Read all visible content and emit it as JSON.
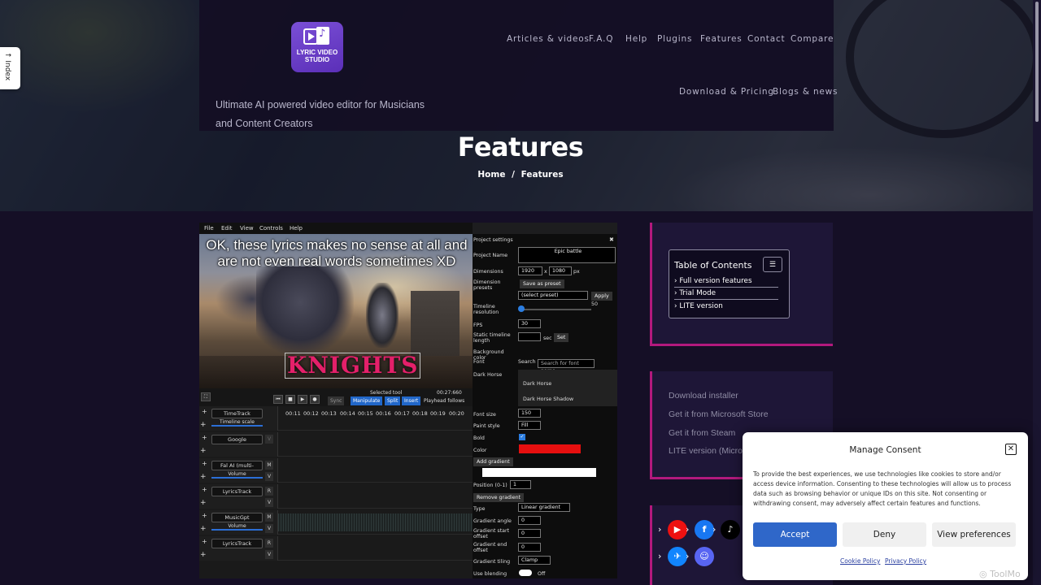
{
  "brand": {
    "logo_text": "LYRIC VIDEO STUDIO",
    "tagline": "Ultimate AI powered video editor for Musicians and Content Creators"
  },
  "nav": {
    "row1": [
      "Articles & videos",
      "F.A.Q",
      "Help",
      "Plugins",
      "Features",
      "Contact",
      "Compare"
    ],
    "row2": [
      "Download & Pricing",
      "Blogs & news"
    ]
  },
  "page": {
    "title": "Features",
    "breadcrumb_home": "Home",
    "breadcrumb_sep": "/",
    "breadcrumb_current": "Features"
  },
  "index_tab": "↑ Index",
  "editor": {
    "menu": [
      "File",
      "Edit",
      "View",
      "Controls",
      "Help"
    ],
    "lyrics": "OK, these lyrics makes no sense at all and are not even real words sometimes XD",
    "title_art": "KNIGHTS",
    "transport": {
      "selected_tool": "Selected tool",
      "time": "00:27:660",
      "sync": "Sync",
      "manipulate": "Manipulate",
      "split": "Split",
      "insert": "Insert",
      "playhead": "Playhead follows"
    },
    "ruler": [
      "00:11",
      "00:12",
      "00:13",
      "00:14",
      "00:15",
      "00:16",
      "00:17",
      "00:18",
      "00:19",
      "00:20"
    ],
    "tracks": [
      {
        "name": "TimeTrack",
        "sub": "Timeline scale",
        "side": []
      },
      {
        "name": "Google",
        "sub": "",
        "side": [
          "V"
        ]
      },
      {
        "name": "Fal AI (multi-",
        "sub": "Volume",
        "side": [
          "M",
          "V"
        ]
      },
      {
        "name": "LyricsTrack",
        "sub": "",
        "side": [
          "R",
          "V"
        ]
      },
      {
        "name": "MusicGpt",
        "sub": "Volume",
        "side": [
          "M",
          "V"
        ]
      },
      {
        "name": "LyricsTrack",
        "sub": "",
        "side": [
          "R",
          "V"
        ]
      }
    ],
    "props": {
      "header": "Project settings",
      "project_name_label": "Project Name",
      "project_name": "Epic battle",
      "dimensions_label": "Dimensions",
      "width": "1920",
      "x": "x",
      "height": "1080",
      "px": "px",
      "presets_label": "Dimension presets",
      "save_preset": "Save as preset",
      "select_preset": "(select preset)",
      "apply": "Apply",
      "timeline_res_label": "Timeline resolution",
      "timeline_res": "50",
      "fps_label": "FPS",
      "fps": "30",
      "static_label": "Static timeline length",
      "sec": "sec",
      "set": "Set",
      "bg_label": "Background color",
      "font_label": "Font",
      "search": "Search",
      "search_placeholder": "Search for font name",
      "font_value": "Dark Horse",
      "font_opt1": "Dark Horse",
      "font_opt2": "Dark Horse Shadow",
      "font_size_label": "Font size",
      "font_size": "150",
      "paint_label": "Paint style",
      "paint": "Fill",
      "bold_label": "Bold",
      "color_label": "Color",
      "add_gradient": "Add gradient",
      "position_label": "Position (0-1)",
      "position": "1",
      "remove_gradient": "Remove gradient",
      "type_label": "Type",
      "type": "Linear gradient",
      "angle_label": "Gradient angle",
      "angle": "0",
      "start_label": "Gradient start offset",
      "start": "0",
      "end_label": "Gradient end offset",
      "end": "0",
      "tiling_label": "Gradient tiling",
      "tiling": "Clamp",
      "blend_label": "Use blending",
      "blend": "Off"
    }
  },
  "toc": {
    "title": "Table of Contents",
    "items": [
      "Full version features",
      "Trial Mode",
      "LITE version"
    ]
  },
  "downloads": [
    "Download installer",
    "Get it from Microsoft Store",
    "Get it from Steam",
    "LITE version (Microsoft Store)"
  ],
  "consent": {
    "title": "Manage Consent",
    "message": "To provide the best experiences, we use technologies like cookies to store and/or access device information. Consenting to these technologies will allow us to process data such as browsing behavior or unique IDs on this site. Not consenting or withdrawing consent, may adversely affect certain features and functions.",
    "accept": "Accept",
    "deny": "Deny",
    "preferences": "View preferences",
    "cookie_policy": "Cookie Policy",
    "privacy_policy": "Privacy Policy"
  },
  "watermark": "ToolMo",
  "colors": {
    "accent": "#b3197d",
    "accept": "#2f67c9",
    "bg": "#150f26"
  },
  "icons": [
    "youtube-icon",
    "facebook-icon",
    "tiktok-icon",
    "bluesky-icon",
    "discord-icon"
  ]
}
